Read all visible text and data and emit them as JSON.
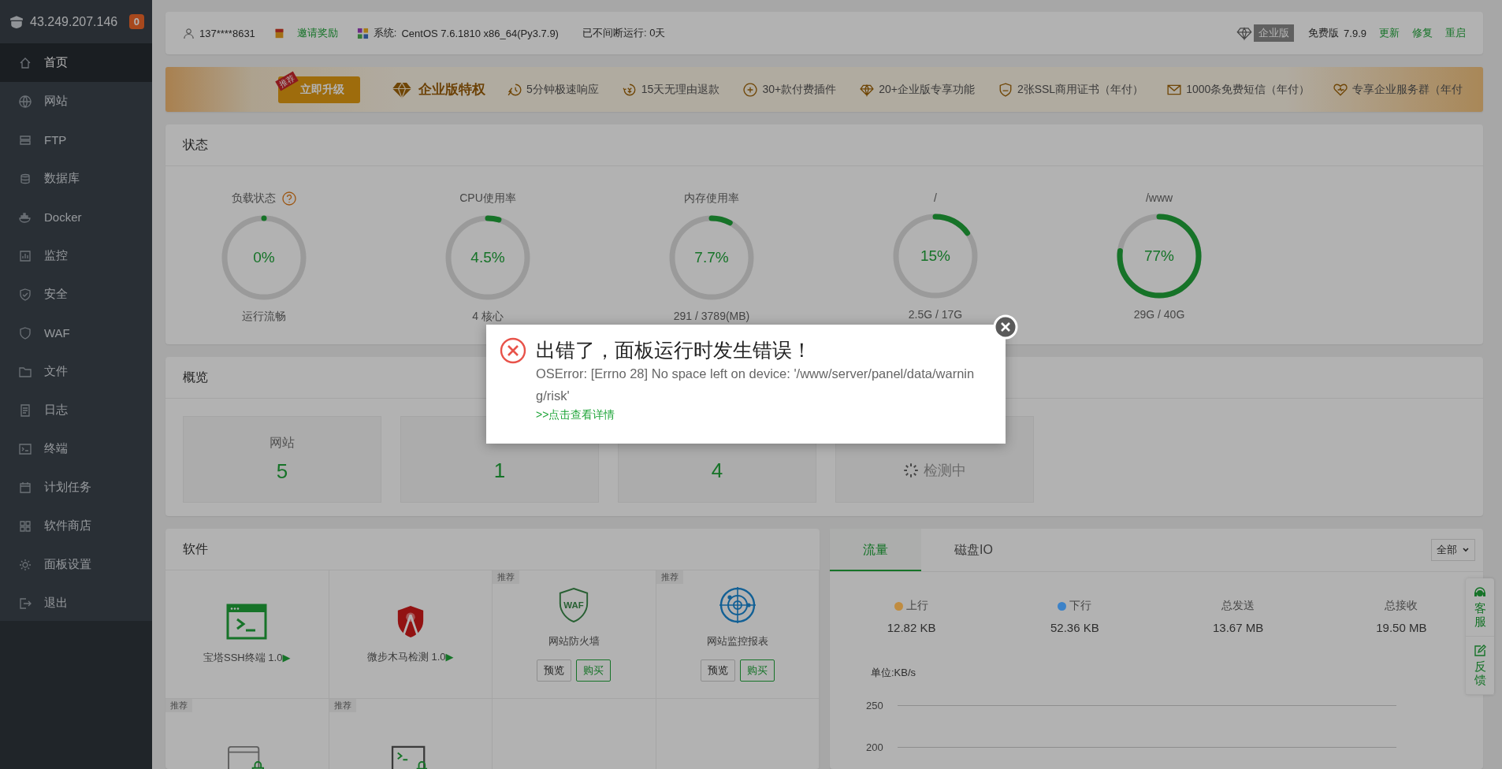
{
  "sidebar": {
    "host": "43.249.207.146",
    "badge": "0",
    "items": [
      {
        "label": "首页",
        "selected": true
      },
      {
        "label": "网站",
        "selected": false
      },
      {
        "label": "FTP",
        "selected": false
      },
      {
        "label": "数据库",
        "selected": false
      },
      {
        "label": "Docker",
        "selected": false
      },
      {
        "label": "监控",
        "selected": false
      },
      {
        "label": "安全",
        "selected": false
      },
      {
        "label": "WAF",
        "selected": false
      },
      {
        "label": "文件",
        "selected": false
      },
      {
        "label": "日志",
        "selected": false
      },
      {
        "label": "终端",
        "selected": false
      },
      {
        "label": "计划任务",
        "selected": false
      },
      {
        "label": "软件商店",
        "selected": false
      },
      {
        "label": "面板设置",
        "selected": false
      },
      {
        "label": "退出",
        "selected": false
      }
    ]
  },
  "header": {
    "user": "137****8631",
    "invite": "邀请奖励",
    "system_label": "系统:",
    "system": "CentOS 7.6.1810 x86_64(Py3.7.9)",
    "uptime": "已不间断运行: 0天",
    "edition_tag": "企业版",
    "edition": "免费版",
    "version": "7.9.9",
    "actions": [
      "更新",
      "修复",
      "重启"
    ]
  },
  "banner": {
    "ribbon": "推荐",
    "upgrade_button": "立即升级",
    "title": "企业版特权",
    "features": [
      "5分钟极速响应",
      "15天无理由退款",
      "30+款付费插件",
      "20+企业版专享功能",
      "2张SSL商用证书（年付）",
      "1000条免费短信（年付）",
      "专享企业服务群（年付"
    ]
  },
  "status": {
    "title": "状态",
    "gauges": [
      {
        "label": "负载状态",
        "help": true,
        "value": "0%",
        "level": 0,
        "caption": "运行流畅"
      },
      {
        "label": "CPU使用率",
        "help": false,
        "value": "4.5%",
        "level": 0.045,
        "caption": "4 核心"
      },
      {
        "label": "内存使用率",
        "help": false,
        "value": "7.7%",
        "level": 0.077,
        "caption": "291 / 3789(MB)"
      },
      {
        "label": "/",
        "help": false,
        "value": "15%",
        "level": 0.15,
        "caption": "2.5G / 17G"
      },
      {
        "label": "/www",
        "help": false,
        "value": "77%",
        "level": 0.77,
        "caption": "29G / 40G"
      }
    ]
  },
  "overview": {
    "title": "概览",
    "cards": [
      {
        "kind": "count",
        "label": "网站",
        "value": "5"
      },
      {
        "kind": "count",
        "value": "1"
      },
      {
        "kind": "count",
        "value": "4"
      },
      {
        "kind": "loading",
        "value": "检测中"
      }
    ]
  },
  "software": {
    "title": "软件",
    "items": [
      {
        "name": "宝塔SSH终端 1.0",
        "arrow": "▶"
      },
      {
        "name": "微步木马检测 1.0",
        "arrow": "▶"
      },
      {
        "icon_text": "WAF",
        "name": "网站防火墙",
        "tag": "推荐",
        "buttons": [
          {
            "label": "预览",
            "kind": "plain"
          },
          {
            "label": "购买",
            "kind": "primary"
          }
        ]
      },
      {
        "name": "网站监控报表",
        "tag": "推荐",
        "buttons": [
          {
            "label": "预览",
            "kind": "plain"
          },
          {
            "label": "购买",
            "kind": "primary"
          }
        ]
      },
      {
        "tag": "推荐"
      },
      {
        "tag": "推荐"
      }
    ]
  },
  "traffic": {
    "tabs": [
      {
        "label": "流量",
        "selected": true
      },
      {
        "label": "磁盘IO",
        "selected": false
      }
    ],
    "filter": "全部",
    "stats": [
      {
        "label": "上行",
        "value": "12.82 KB",
        "color": "#c08c40"
      },
      {
        "label": "下行",
        "value": "52.36 KB",
        "color": "#3c82c8"
      },
      {
        "label": "总发送",
        "value": "13.67 MB"
      },
      {
        "label": "总接收",
        "value": "19.50 MB"
      }
    ],
    "unit": "单位:KB/s",
    "y_ticks": [
      "250",
      "200"
    ]
  },
  "float_tabs": [
    "客服",
    "反馈"
  ],
  "dialog": {
    "title": "出错了，面板运行时发生错误！",
    "message": "OSError: [Errno 28] No space left on device: '/www/server/panel/data/warning/risk'",
    "link": ">>点击查看详情"
  }
}
